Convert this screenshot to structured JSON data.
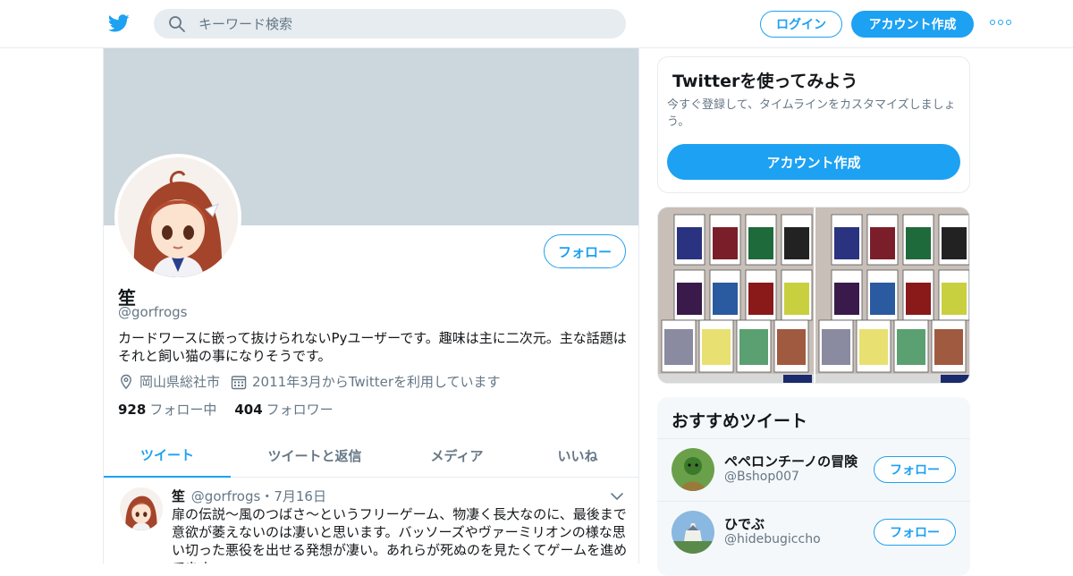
{
  "header": {
    "logo_icon": "twitter-bird-icon",
    "search_placeholder": "キーワード検索",
    "login_label": "ログイン",
    "signup_label": "アカウント作成",
    "more_icon": "more-dots-icon"
  },
  "profile": {
    "name": "笙",
    "handle": "@gorfrogs",
    "follow_label": "フォロー",
    "bio": "カードワースに嵌って抜けられないPyユーザーです。趣味は主に二次元。主な話題はそれと飼い猫の事になりそうです。",
    "location": "岡山県総社市",
    "joined": "2011年3月からTwitterを利用しています",
    "following_count": "928",
    "following_label": "フォロー中",
    "followers_count": "404",
    "followers_label": "フォロワー"
  },
  "tabs": [
    {
      "label": "ツイート"
    },
    {
      "label": "ツイートと返信"
    },
    {
      "label": "メディア"
    },
    {
      "label": "いいね"
    }
  ],
  "tweet": {
    "name": "笙",
    "handle": "@gorfrogs",
    "dot": "・",
    "date": "7月16日",
    "text": "扉の伝説～風のつばさ～というフリーゲーム、物凄く長大なのに、最後まで意欲が萎えないのは凄いと思います。バッソーズやヴァーミリオンの様な思い切った悪役を出せる発想が凄い。あれらが死ぬのを見たくてゲームを進めてます。"
  },
  "sidebar": {
    "try_title": "Twitterを使ってみよう",
    "try_desc": "今すぐ登録して、タイムラインをカスタマイズしましょう。",
    "try_button": "アカウント作成",
    "rec_title": "おすすめツイート",
    "recommendations": [
      {
        "name": "ペペロンチーノの冒険",
        "handle": "@Bshop007",
        "button": "フォロー"
      },
      {
        "name": "ひでぶ",
        "handle": "@hidebugiccho",
        "button": "フォロー"
      }
    ]
  },
  "colors": {
    "accent": "#1da1f2",
    "banner": "#ccd6dd",
    "muted": "#657786",
    "border": "#e6ecf0"
  }
}
